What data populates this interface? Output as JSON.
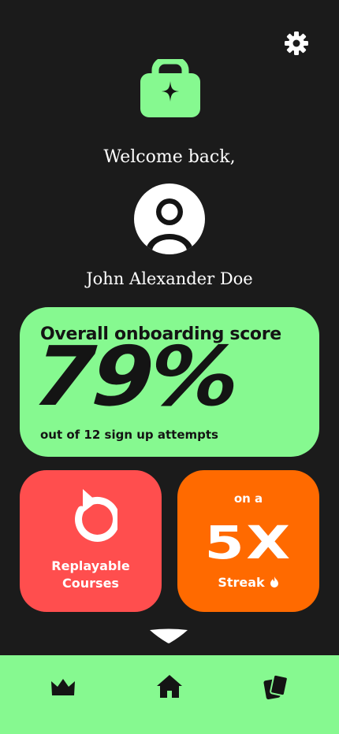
{
  "header": {
    "settings_icon": "gear-icon",
    "logo_icon": "briefcase-sparkle-icon"
  },
  "profile": {
    "greeting": "Welcome back,",
    "avatar_icon": "user-avatar-icon",
    "name": "John Alexander Doe"
  },
  "score": {
    "title": "Overall onboarding score",
    "value": "79%",
    "subtitle": "out of 12 sign up attempts",
    "percent": 79,
    "attempts": 12
  },
  "replay": {
    "icon": "replay-icon",
    "label": "Replayable\nCourses"
  },
  "streak": {
    "prefix": "on a",
    "value": "5X",
    "label": "Streak",
    "icon": "flame-icon"
  },
  "nav": {
    "items": [
      {
        "icon": "crown-icon"
      },
      {
        "icon": "home-icon"
      },
      {
        "icon": "cards-icon"
      }
    ]
  },
  "colors": {
    "background": "#1b1b1b",
    "accent_green": "#86f990",
    "card_red": "#ff4e4e",
    "card_orange": "#ff6a00",
    "dark_text": "#141414"
  }
}
